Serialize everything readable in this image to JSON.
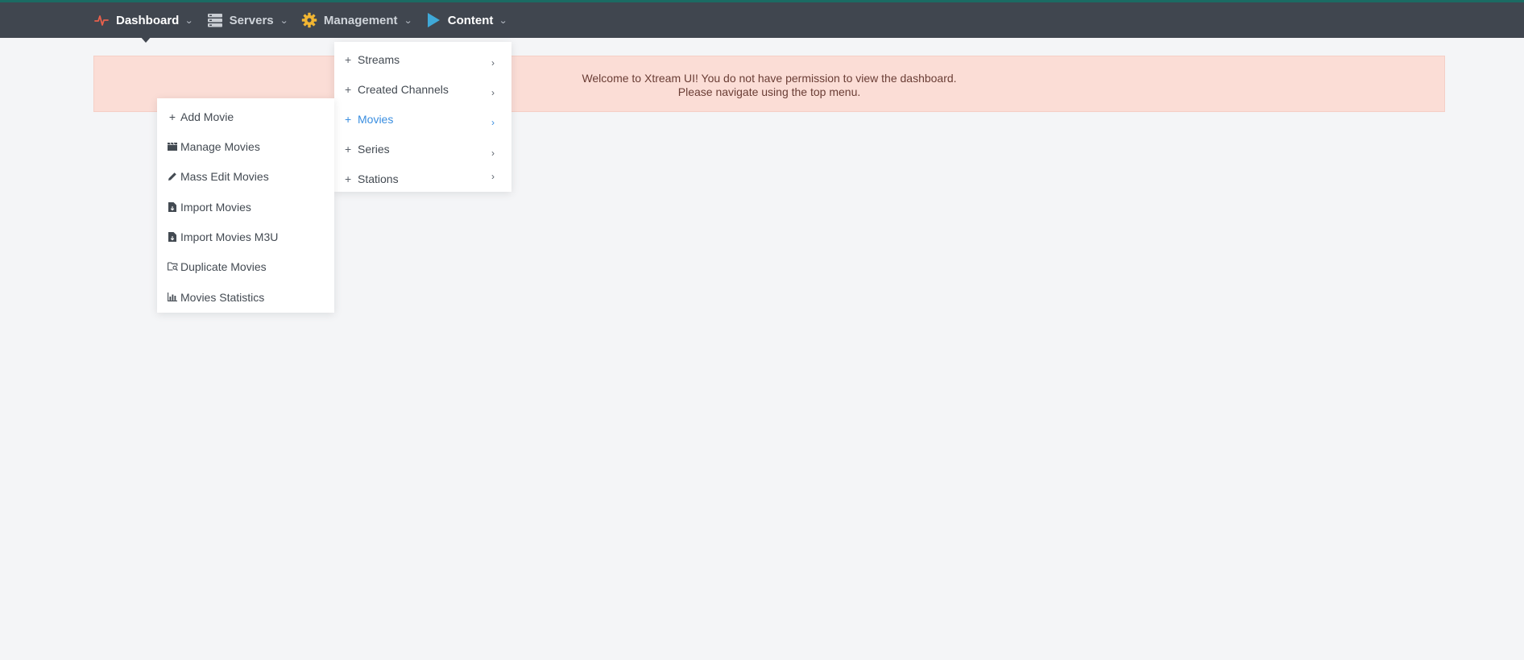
{
  "nav": {
    "items": [
      {
        "label": "Dashboard",
        "icon": "pulse-icon"
      },
      {
        "label": "Servers",
        "icon": "server-icon"
      },
      {
        "label": "Management",
        "icon": "gear-icon"
      },
      {
        "label": "Content",
        "icon": "play-icon"
      }
    ]
  },
  "alert": {
    "line1": "Welcome to Xtream UI! You do not have permission to view the dashboard.",
    "line2": "Please navigate using the top menu."
  },
  "content_menu": {
    "items": [
      "Streams",
      "Created Channels",
      "Movies",
      "Series",
      "Stations"
    ],
    "active": "Movies"
  },
  "movies_menu": {
    "items": [
      {
        "label": "Add Movie",
        "icon": "plus-icon"
      },
      {
        "label": "Manage Movies",
        "icon": "clapperboard-icon"
      },
      {
        "label": "Mass Edit Movies",
        "icon": "pencil-icon"
      },
      {
        "label": "Import Movies",
        "icon": "file-import-icon"
      },
      {
        "label": "Import Movies M3U",
        "icon": "file-import-icon"
      },
      {
        "label": "Duplicate Movies",
        "icon": "folder-search-icon"
      },
      {
        "label": "Movies Statistics",
        "icon": "bar-chart-icon"
      }
    ]
  },
  "colors": {
    "topbar": "#40464f",
    "accent_link": "#3a8ee0",
    "alert_bg": "#fbddd6",
    "pulse": "#e8604c",
    "gear": "#f2b632",
    "play": "#3fa9d8"
  }
}
